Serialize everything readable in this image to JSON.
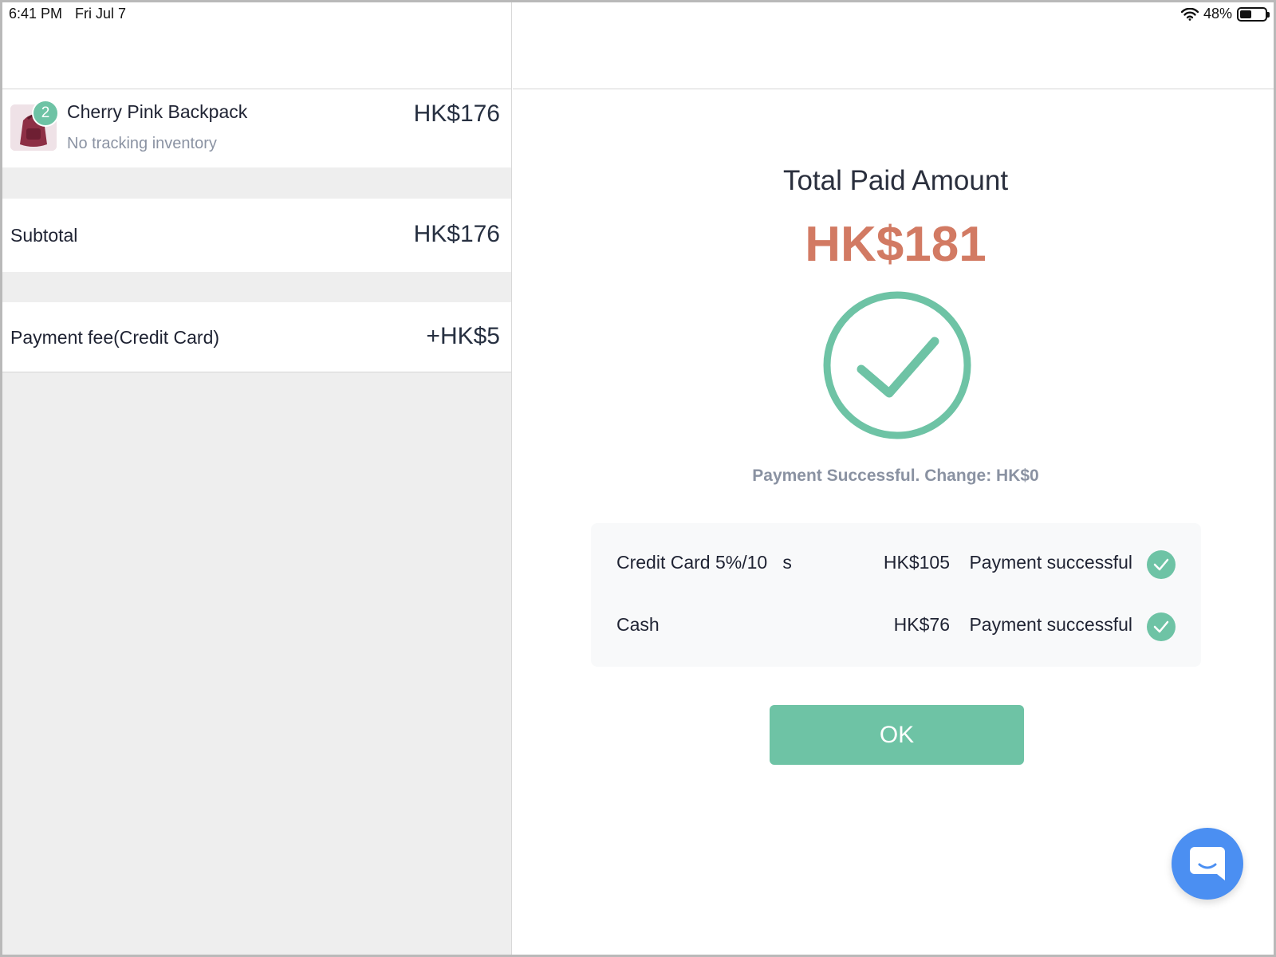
{
  "status_bar": {
    "time": "6:41 PM",
    "date": "Fri Jul 7",
    "battery_percent": "48%",
    "battery_level": 0.48,
    "wifi_icon": "wifi-icon"
  },
  "cart": {
    "item": {
      "name": "Cherry Pink Backpack",
      "subtitle": "No tracking inventory",
      "price": "HK$176",
      "quantity": "2",
      "thumbnail_icon": "backpack-thumbnail"
    },
    "subtotal": {
      "label": "Subtotal",
      "value": "HK$176"
    },
    "payment_fee": {
      "label": "Payment fee(Credit Card)",
      "value": "+HK$5"
    }
  },
  "summary": {
    "total_label": "Total Paid Amount",
    "total_amount": "HK$181",
    "success_message": "Payment Successful. Change: HK$0",
    "payments": [
      {
        "method": "Credit Card 5%/10   s",
        "amount": "HK$105",
        "status": "Payment successful"
      },
      {
        "method": "Cash",
        "amount": "HK$76",
        "status": "Payment successful"
      }
    ],
    "ok_label": "OK"
  },
  "colors": {
    "accent_green": "#6ec3a5",
    "total_amount": "#d27a63",
    "chat_blue": "#4b8ff2"
  }
}
